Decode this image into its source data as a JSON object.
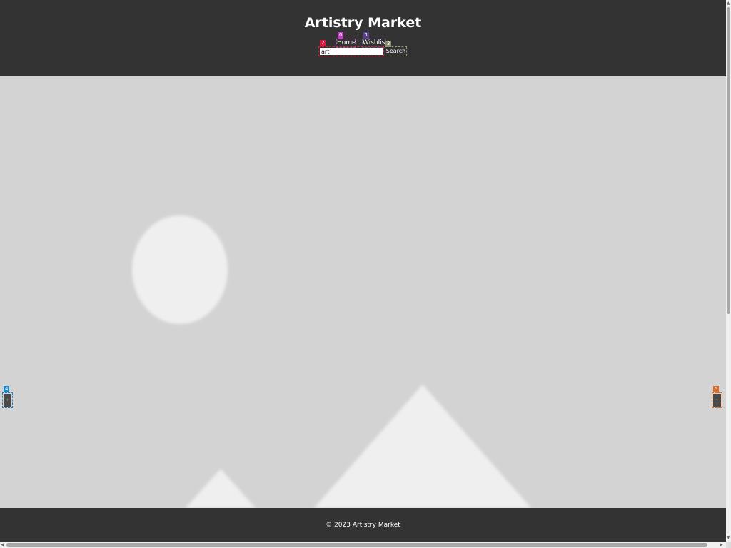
{
  "header": {
    "title": "Artistry Market",
    "nav": [
      {
        "label": "Home",
        "badge": "0"
      },
      {
        "label": "Wishlist",
        "badge": "1"
      }
    ],
    "search": {
      "value": "art",
      "badge": "2",
      "button_label": "Search",
      "button_badge": "3"
    }
  },
  "carousel": {
    "image_icon": "image-placeholder-icon",
    "prev_badge": "4",
    "next_badge": "5",
    "prev_icon": "chevron-left-icon",
    "next_icon": "chevron-right-icon"
  },
  "footer": {
    "copyright": "© 2023 Artistry Market"
  },
  "colors": {
    "header_bg": "#333333",
    "hero_bg": "#d3d3d3",
    "badge_home": "#c040c0",
    "badge_wishlist": "#5a3f90",
    "badge_search_input": "#e0193c",
    "badge_search_button": "#8a8a6a",
    "badge_prev": "#1a88c8",
    "badge_next": "#e06a20"
  }
}
